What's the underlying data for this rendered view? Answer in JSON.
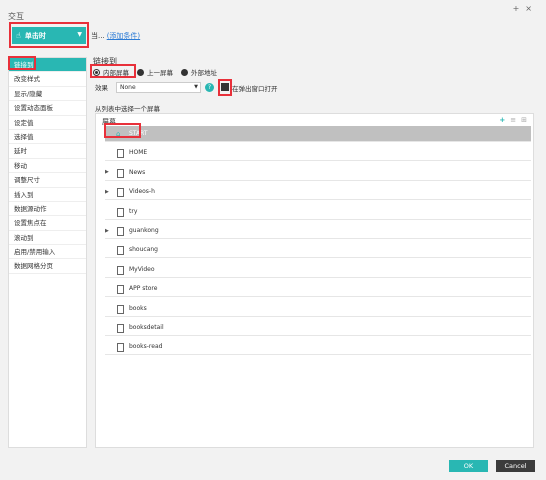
{
  "window": {
    "title": "交互",
    "pin_icon": "+",
    "close_icon": "×"
  },
  "trigger": {
    "label": "单击时",
    "icon": "pointer-hand-icon"
  },
  "when": {
    "prefix": "当...",
    "add_condition": "(添加条件)"
  },
  "sidebar": {
    "items": [
      {
        "label": "链接到",
        "active": true
      },
      {
        "label": "改变样式"
      },
      {
        "label": "显示/隐藏"
      },
      {
        "label": "设置动态面板"
      },
      {
        "label": "设定值"
      },
      {
        "label": "选择值"
      },
      {
        "label": "延时"
      },
      {
        "label": "移动"
      },
      {
        "label": "调整尺寸"
      },
      {
        "label": "插入到"
      },
      {
        "label": "数据源动作"
      },
      {
        "label": "设置焦点在"
      },
      {
        "label": "滚动到"
      },
      {
        "label": "启用/禁用输入"
      },
      {
        "label": "数据网格分页"
      }
    ]
  },
  "link": {
    "title": "链接到",
    "options": [
      {
        "label": "内部屏幕",
        "selected": true
      },
      {
        "label": "上一屏幕"
      },
      {
        "label": "外部地址"
      }
    ],
    "effect_label": "效果",
    "effect_value": "None",
    "help_icon": "?",
    "popup_label": "在弹出窗口打开"
  },
  "screens": {
    "list_title": "从列表中选择一个屏幕",
    "header": "屏幕",
    "tools": [
      "+",
      "≡",
      "⊞"
    ],
    "items": [
      {
        "label": "START",
        "type": "home",
        "selected": true,
        "expandable": false
      },
      {
        "label": "HOME",
        "type": "page",
        "expandable": false
      },
      {
        "label": "News",
        "type": "page",
        "expandable": true
      },
      {
        "label": "Videos-h",
        "type": "page",
        "expandable": true
      },
      {
        "label": "try",
        "type": "page",
        "expandable": false
      },
      {
        "label": "guankong",
        "type": "page",
        "expandable": true
      },
      {
        "label": "shoucang",
        "type": "page",
        "expandable": false
      },
      {
        "label": "MyVideo",
        "type": "page",
        "expandable": false
      },
      {
        "label": "APP store",
        "type": "page",
        "expandable": false
      },
      {
        "label": "books",
        "type": "page",
        "expandable": false
      },
      {
        "label": "booksdetail",
        "type": "page",
        "expandable": false
      },
      {
        "label": "books-read",
        "type": "page",
        "expandable": false
      }
    ]
  },
  "footer": {
    "ok": "OK",
    "cancel": "Cancel"
  },
  "colors": {
    "accent": "#29b7b3",
    "highlight": "#e8303a",
    "cancel": "#3c3c3c"
  }
}
